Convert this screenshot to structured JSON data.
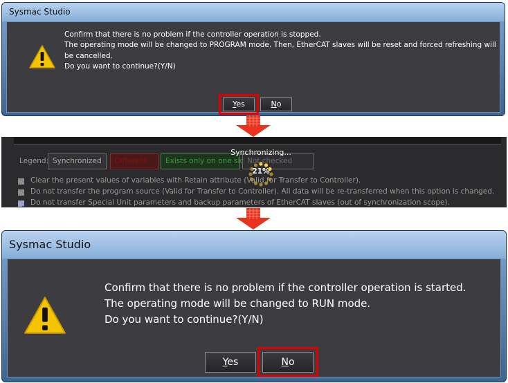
{
  "dialog_stop": {
    "title": "Sysmac Studio",
    "message_lines": [
      "Confirm that there is no problem if the controller operation is stopped.",
      "The operating mode will be changed to PROGRAM mode. Then, EtherCAT slaves will be reset and forced refreshing will",
      "be cancelled.",
      "Do you want to continue?(Y/N)"
    ],
    "yes_mnemonic": "Y",
    "yes_rest": "es",
    "no_mnemonic": "N",
    "no_rest": "o",
    "highlighted": "yes"
  },
  "sync": {
    "legend_label": "Legend:",
    "legend_synchronized": "Synchronized",
    "legend_different": "Different",
    "legend_exists_one_side": "Exists only on one side",
    "legend_not_checked": "Not checked",
    "progress_title": "Synchronizing...",
    "progress_percent": "21%",
    "progress_value": 0.21,
    "options": [
      {
        "checked": false,
        "label": "Clear the present values of variables with Retain attribute (Valid for Transfer to Controller)."
      },
      {
        "checked": false,
        "label": "Do not transfer the program source (Valid for Transfer to Controller). All data will be re-transferred when this option is changed."
      },
      {
        "checked": true,
        "label": "Do not transfer Special Unit parameters and backup parameters of EtherCAT slaves (out of synchronization scope)."
      }
    ]
  },
  "dialog_start": {
    "title": "Sysmac Studio",
    "message_lines": [
      "Confirm that there is no problem if the controller operation is started.",
      "The operating mode will be changed to RUN mode.",
      "Do you want to continue?(Y/N)"
    ],
    "yes_mnemonic": "Y",
    "yes_rest": "es",
    "no_mnemonic": "N",
    "no_rest": "o",
    "highlighted": "no"
  },
  "colors": {
    "highlight": "#e00000",
    "arrow": "#e8331e",
    "dialog_body": "#3d3d41",
    "warning": "#f5c400"
  },
  "icons": {
    "warning": "warning-triangle-icon",
    "flow_arrow": "down-arrow-icon",
    "spinner": "loading-spinner-icon"
  }
}
